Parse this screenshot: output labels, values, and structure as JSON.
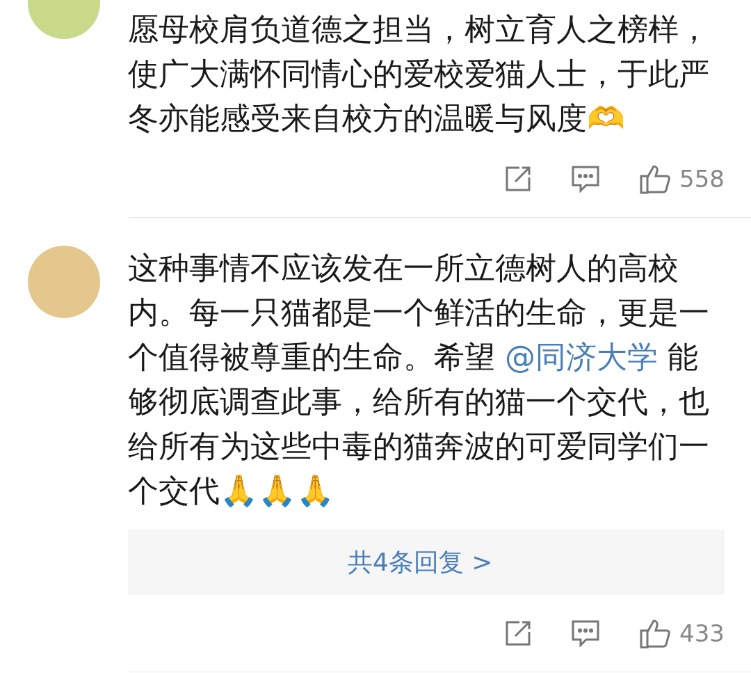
{
  "comments": [
    {
      "text": [
        {
          "kind": "text",
          "value": "愿母校肩负道德之担当，树立育人之榜样，使广大满怀同情心的爱校爱猫人士，于此严冬亦能感受来自校方的温暖与风度🫶"
        }
      ],
      "likes": "558"
    },
    {
      "text": [
        {
          "kind": "text",
          "value": "这种事情不应该发在一所立德树人的高校内。每一只猫都是一个鲜活的生命，更是一个值得被尊重的生命。希望 "
        },
        {
          "kind": "mention",
          "value": "@同济大学"
        },
        {
          "kind": "text",
          "value": " 能够彻底调查此事，给所有的猫一个交代，也给所有为这些中毒的猫奔波的可爱同学们一个交代🙏🙏🙏"
        }
      ],
      "replies": "共4条回复 >",
      "likes": "433"
    }
  ]
}
